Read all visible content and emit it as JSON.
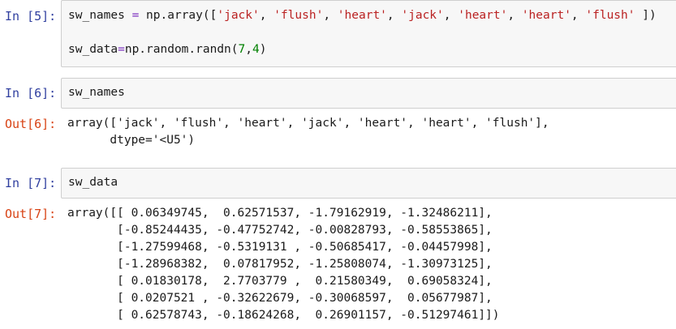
{
  "cells": [
    {
      "in_prompt": "In [5]:",
      "code": {
        "line1": {
          "var": "sw_names",
          "op": " = ",
          "call": "np.array([",
          "items": [
            "'jack'",
            "'flush'",
            "'heart'",
            "'jack'",
            "'heart'",
            "'heart'",
            "'flush'"
          ],
          "sep": ", ",
          "close": " ])"
        },
        "line2": {
          "var": "sw_data",
          "op": "=",
          "call": "np.random.randn(",
          "a": "7",
          "comma": ",",
          "b": "4",
          "close": ")"
        }
      }
    },
    {
      "in_prompt": "In [6]:",
      "code_text": "sw_names",
      "out_prompt": "Out[6]:",
      "output": [
        "array(['jack', 'flush', 'heart', 'jack', 'heart', 'heart', 'flush'],",
        "      dtype='<U5')"
      ]
    },
    {
      "in_prompt": "In [7]:",
      "code_text": "sw_data",
      "out_prompt": "Out[7]:",
      "output": [
        "array([[ 0.06349745,  0.62571537, -1.79162919, -1.32486211],",
        "       [-0.85244435, -0.47752742, -0.00828793, -0.58553865],",
        "       [-1.27599468, -0.5319131 , -0.50685417, -0.04457998],",
        "       [-1.28968382,  0.07817952, -1.25808074, -1.30973125],",
        "       [ 0.01830178,  2.7703779 ,  0.21580349,  0.69058324],",
        "       [ 0.0207521 , -0.32622679, -0.30068597,  0.05677987],",
        "       [ 0.62578743, -0.18624268,  0.26901157, -0.51297461]])"
      ]
    }
  ]
}
